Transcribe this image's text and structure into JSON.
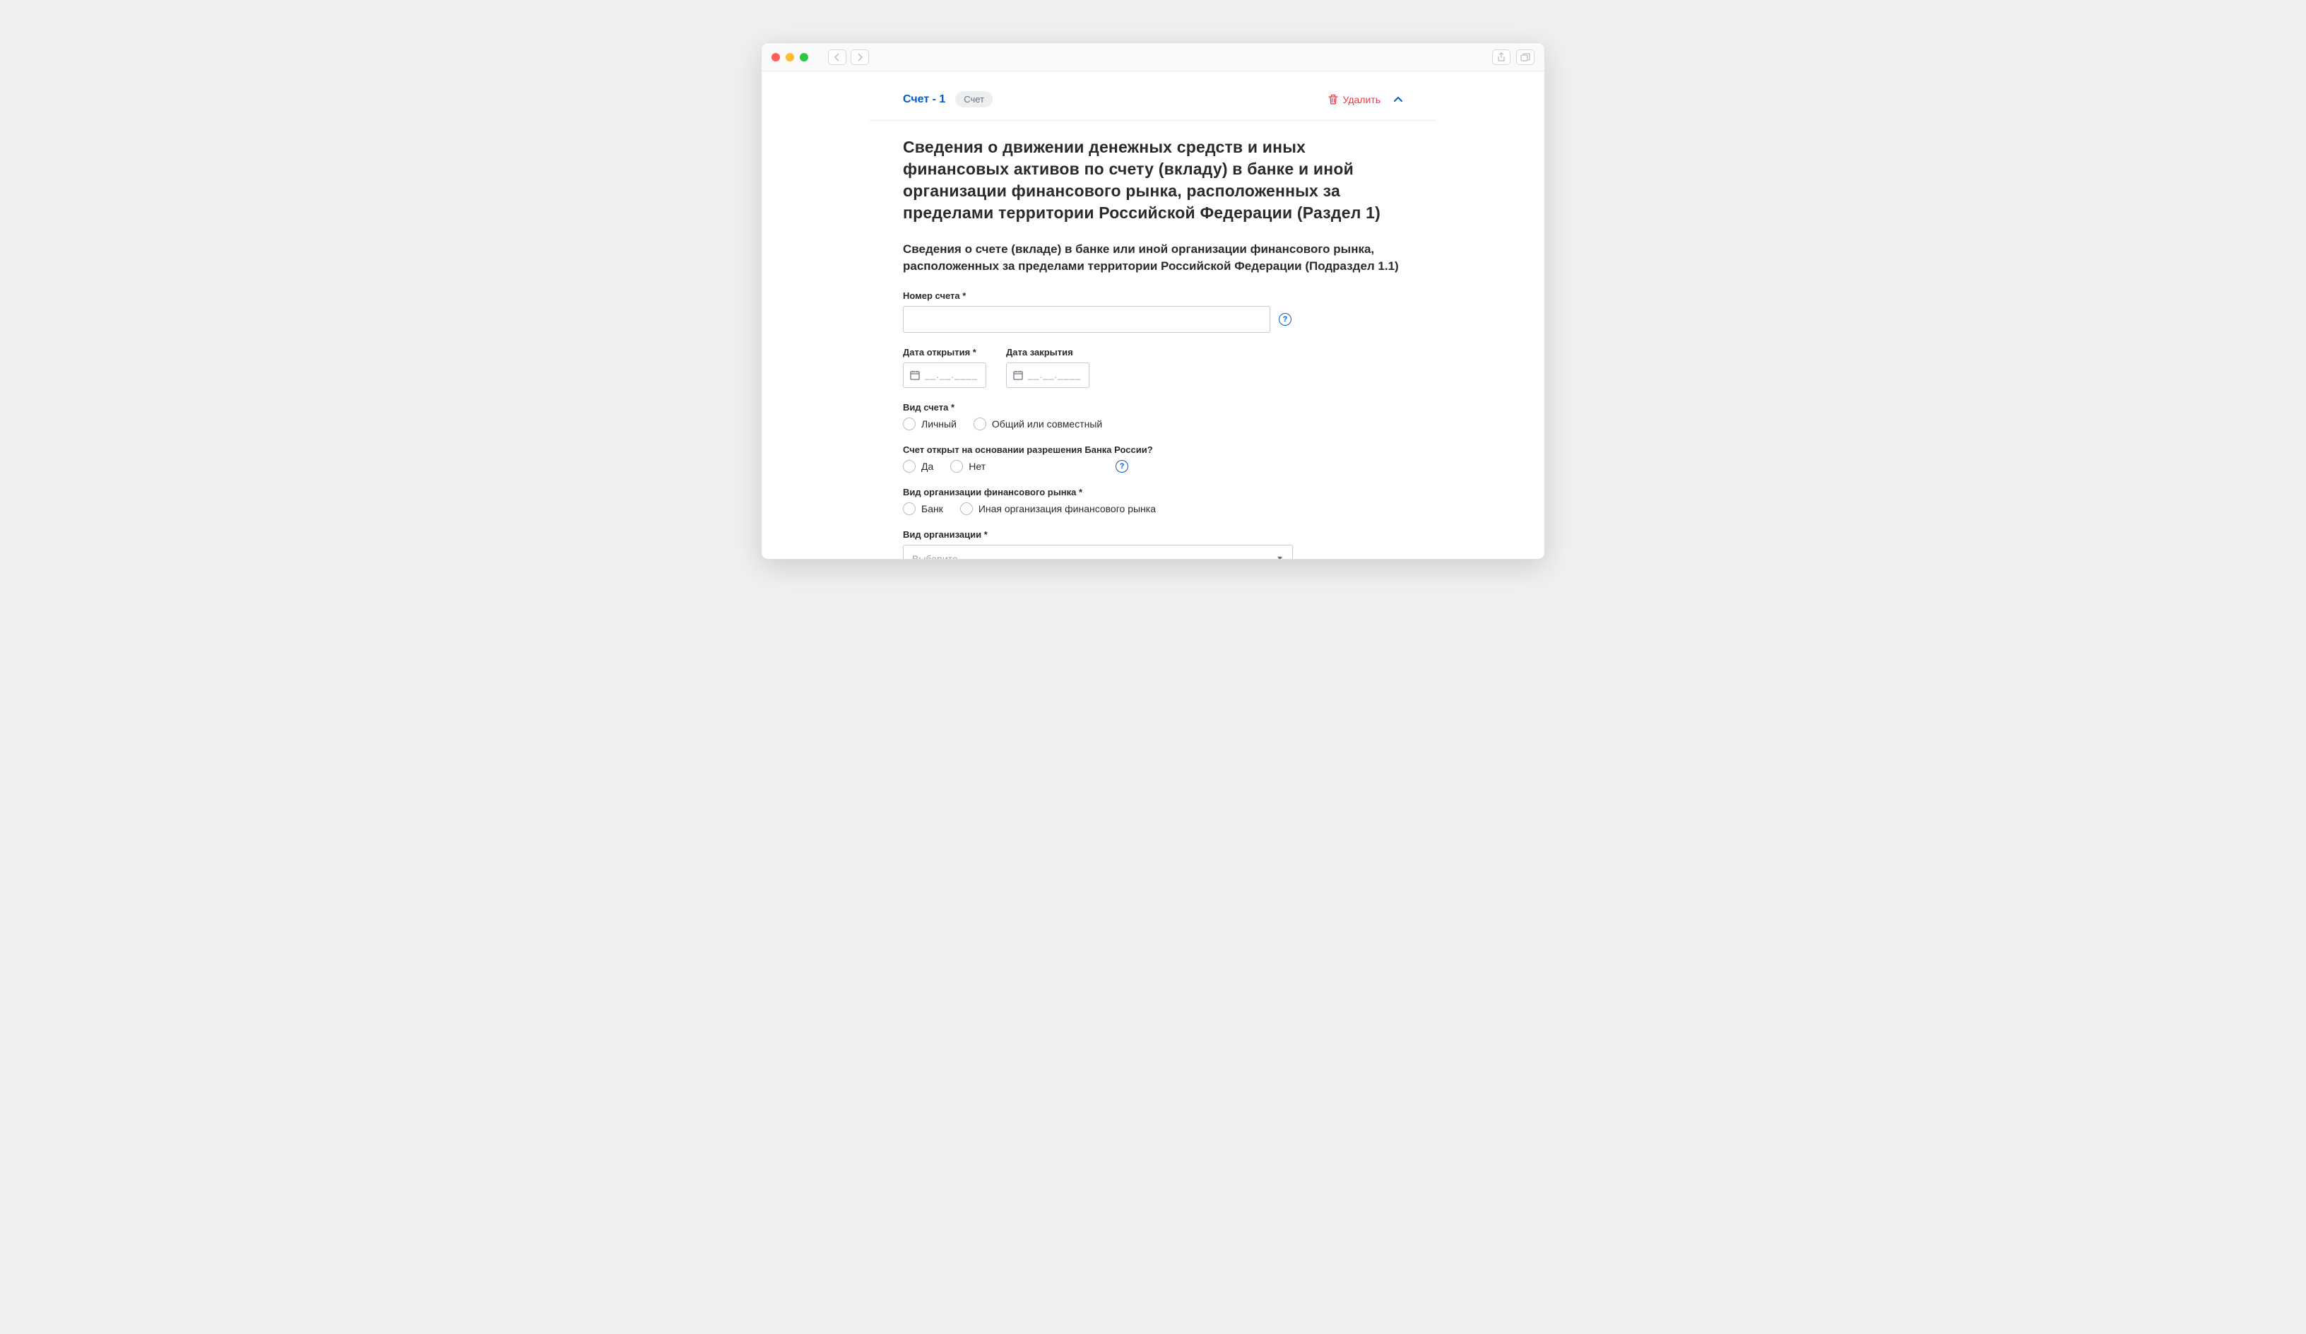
{
  "window": {
    "card_title": "Счет - 1",
    "tag": "Счет",
    "delete_label": "Удалить"
  },
  "headings": {
    "main": "Сведения о движении денежных средств и иных финансовых активов по счету (вкладу) в банке и иной организации финансового рынка, расположенных за пределами территории Российской Федерации (Раздел 1)",
    "sub": "Сведения о счете (вкладе) в банке или иной организации финансового рынка, расположенных за пределами территории Российской Федерации (Подраздел 1.1)"
  },
  "fields": {
    "account_number": {
      "label": "Номер счета *",
      "value": ""
    },
    "open_date": {
      "label": "Дата открытия *",
      "placeholder": "__.__.____"
    },
    "close_date": {
      "label": "Дата закрытия",
      "placeholder": "__.__.____"
    },
    "account_type": {
      "label": "Вид счета *",
      "options": {
        "personal": "Личный",
        "joint": "Общий или совместный"
      }
    },
    "bank_permission": {
      "label": "Счет открыт на основании разрешения Банка России?",
      "options": {
        "yes": "Да",
        "no": "Нет"
      }
    },
    "org_market_type": {
      "label": "Вид организации финансового рынка *",
      "options": {
        "bank": "Банк",
        "other": "Иная организация финансового рынка"
      }
    },
    "org_type": {
      "label": "Вид организации *",
      "placeholder": "Выберите"
    }
  }
}
